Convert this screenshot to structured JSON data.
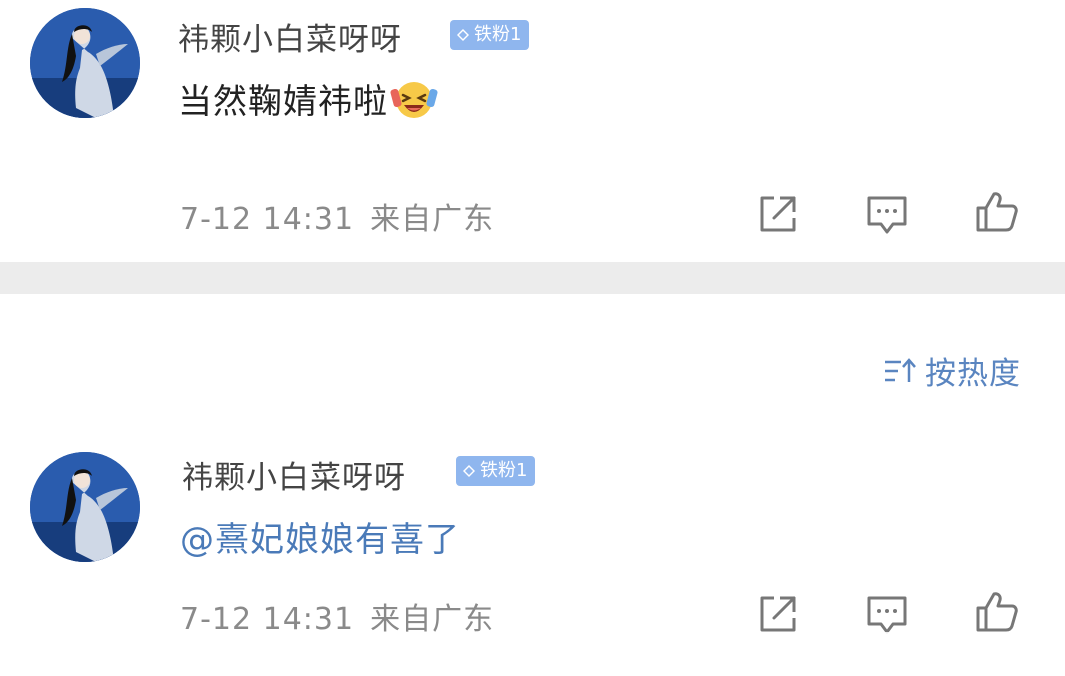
{
  "comments": [
    {
      "username": "祎颗小白菜呀呀",
      "badge": "铁粉1",
      "content_text": "当然鞠婧祎啦",
      "emoji": "laugh-cry-emoji",
      "time": "7-12 14:31",
      "location": "来自广东"
    },
    {
      "username": "祎颗小白菜呀呀",
      "badge": "铁粉1",
      "content_text": "@熹妃娘娘有喜了",
      "time": "7-12 14:31",
      "location": "来自广东"
    }
  ],
  "sort": {
    "label": "按热度"
  },
  "icons": {
    "share": "share-icon",
    "comment": "comment-icon",
    "like": "thumbs-up-icon",
    "sort": "sort-icon",
    "badge": "diamond-icon"
  },
  "colors": {
    "mention": "#4a7ab8",
    "badge_bg": "#8fb6ee",
    "sort_text": "#5a85c0",
    "meta_text": "#8a8a8a",
    "divider": "#ececec"
  }
}
